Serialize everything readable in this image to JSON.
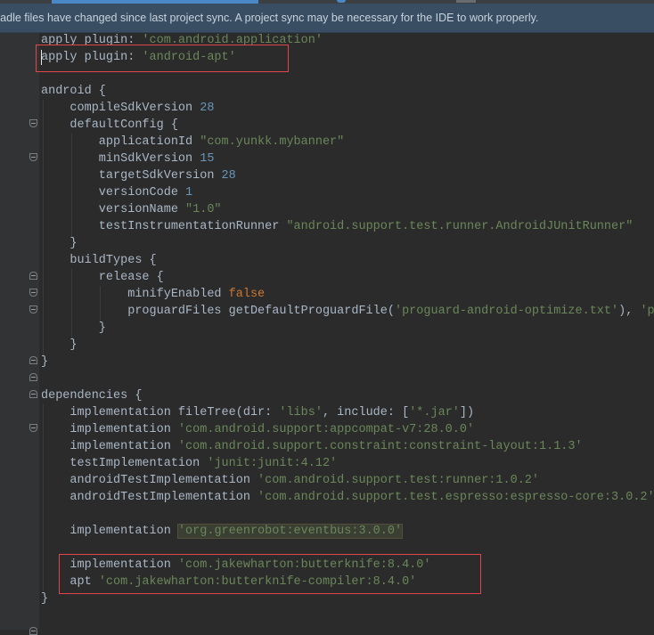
{
  "notification": {
    "text": "radle files have changed since last project sync. A project sync may be necessary for the IDE to work properly."
  },
  "colors": {
    "background": "#2b2b2b",
    "gutter": "#313335",
    "default_text": "#a9b7c6",
    "string": "#6a8759",
    "number": "#6897bb",
    "keyword": "#cc7832",
    "highlight_box": "#e0464b",
    "notification_bar": "#394e63"
  },
  "code": {
    "lines": [
      [
        {
          "t": "apply plugin: ",
          "c": "plain"
        },
        {
          "t": "'com.android.application'",
          "c": "str"
        }
      ],
      [
        {
          "t": "apply plugin: ",
          "c": "plain"
        },
        {
          "t": "'android-apt'",
          "c": "str"
        }
      ],
      [],
      [
        {
          "t": "android {",
          "c": "plain"
        }
      ],
      [
        {
          "t": "    compileSdkVersion ",
          "c": "plain"
        },
        {
          "t": "28",
          "c": "num"
        }
      ],
      [
        {
          "t": "    defaultConfig {",
          "c": "plain"
        }
      ],
      [
        {
          "t": "        applicationId ",
          "c": "plain"
        },
        {
          "t": "\"com.yunkk.mybanner\"",
          "c": "str"
        }
      ],
      [
        {
          "t": "        minSdkVersion ",
          "c": "plain"
        },
        {
          "t": "15",
          "c": "num"
        }
      ],
      [
        {
          "t": "        targetSdkVersion ",
          "c": "plain"
        },
        {
          "t": "28",
          "c": "num"
        }
      ],
      [
        {
          "t": "        versionCode ",
          "c": "plain"
        },
        {
          "t": "1",
          "c": "num"
        }
      ],
      [
        {
          "t": "        versionName ",
          "c": "plain"
        },
        {
          "t": "\"1.0\"",
          "c": "str"
        }
      ],
      [
        {
          "t": "        testInstrumentationRunner ",
          "c": "plain"
        },
        {
          "t": "\"android.support.test.runner.AndroidJUnitRunner\"",
          "c": "str"
        }
      ],
      [
        {
          "t": "    }",
          "c": "plain"
        }
      ],
      [
        {
          "t": "    buildTypes {",
          "c": "plain"
        }
      ],
      [
        {
          "t": "        release {",
          "c": "plain"
        }
      ],
      [
        {
          "t": "            minifyEnabled ",
          "c": "plain"
        },
        {
          "t": "false",
          "c": "kw"
        }
      ],
      [
        {
          "t": "            proguardFiles getDefaultProguardFile(",
          "c": "plain"
        },
        {
          "t": "'proguard-android-optimize.txt'",
          "c": "str"
        },
        {
          "t": "), ",
          "c": "plain"
        },
        {
          "t": "'pro",
          "c": "str"
        }
      ],
      [
        {
          "t": "        }",
          "c": "plain"
        }
      ],
      [
        {
          "t": "    }",
          "c": "plain"
        }
      ],
      [
        {
          "t": "}",
          "c": "plain"
        }
      ],
      [],
      [
        {
          "t": "dependencies {",
          "c": "plain"
        }
      ],
      [
        {
          "t": "    implementation fileTree(",
          "c": "plain"
        },
        {
          "t": "dir: ",
          "c": "named"
        },
        {
          "t": "'libs'",
          "c": "str"
        },
        {
          "t": ", ",
          "c": "plain"
        },
        {
          "t": "include: ",
          "c": "named"
        },
        {
          "t": "[",
          "c": "plain"
        },
        {
          "t": "'*.jar'",
          "c": "str"
        },
        {
          "t": "])",
          "c": "plain"
        }
      ],
      [
        {
          "t": "    implementation ",
          "c": "plain"
        },
        {
          "t": "'com.android.support:appcompat-v7:28.0.0'",
          "c": "str"
        }
      ],
      [
        {
          "t": "    implementation ",
          "c": "plain"
        },
        {
          "t": "'com.android.support.constraint:constraint-layout:1.1.3'",
          "c": "str"
        }
      ],
      [
        {
          "t": "    testImplementation ",
          "c": "plain"
        },
        {
          "t": "'junit:junit:4.12'",
          "c": "str"
        }
      ],
      [
        {
          "t": "    androidTestImplementation ",
          "c": "plain"
        },
        {
          "t": "'com.android.support.test:runner:1.0.2'",
          "c": "str"
        }
      ],
      [
        {
          "t": "    androidTestImplementation ",
          "c": "plain"
        },
        {
          "t": "'com.android.support.test.espresso:espresso-core:3.0.2'",
          "c": "str"
        }
      ],
      [],
      [
        {
          "t": "    implementation ",
          "c": "plain"
        },
        {
          "t": "'org.greenrobot:eventbus:3.0.0'",
          "c": "hlbg"
        }
      ],
      [],
      [
        {
          "t": "    implementation ",
          "c": "plain"
        },
        {
          "t": "'com.jakewharton:butterknife:8.4.0'",
          "c": "str"
        }
      ],
      [
        {
          "t": "    apt ",
          "c": "plain"
        },
        {
          "t": "'com.jakewharton:butterknife-compiler:8.4.0'",
          "c": "str"
        }
      ],
      [
        {
          "t": "}",
          "c": "plain"
        }
      ]
    ]
  }
}
